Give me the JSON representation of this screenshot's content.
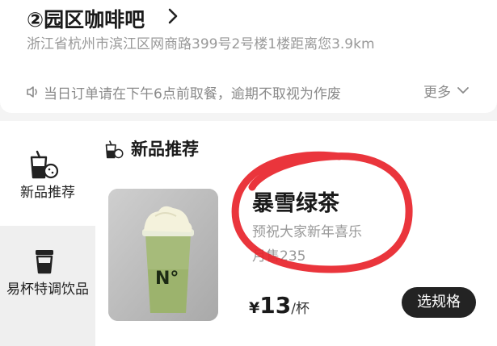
{
  "store": {
    "name": "②园区咖啡吧",
    "address": "浙江省杭州市滨江区网商路399号2号楼1楼距离您3.9km",
    "notice": "当日订单请在下午6点前取餐，逾期不取视为作废",
    "more_label": "更多"
  },
  "sidebar": {
    "items": [
      {
        "label": "新品推荐",
        "icon": "new-drink-icon",
        "active": true
      },
      {
        "label": "易杯特调饮品",
        "icon": "cup-icon",
        "active": false
      }
    ]
  },
  "section": {
    "title": "新品推荐",
    "icon": "new-drink-icon"
  },
  "product": {
    "name": "暴雪绿茶",
    "description": "预祝大家新年喜乐",
    "sold": "月售235",
    "currency": "¥",
    "price": "13",
    "unit": "/杯",
    "spec_button": "选规格",
    "cup_logo": "N°"
  },
  "colors": {
    "annotation": "#e8242b",
    "button": "#232323",
    "muted_text": "#999999"
  }
}
